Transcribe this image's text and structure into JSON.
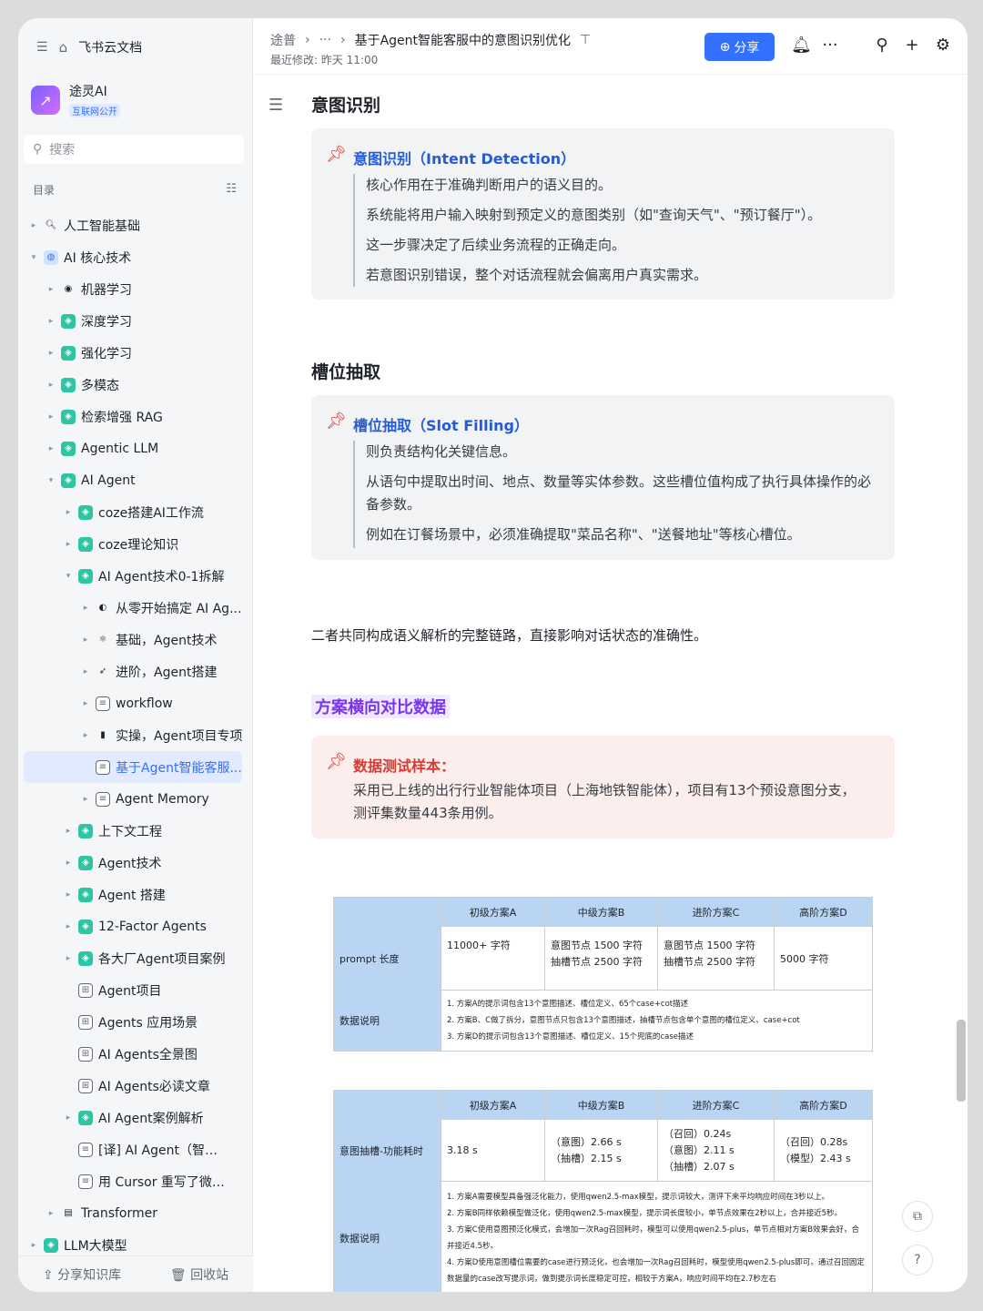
{
  "sidebar": {
    "app_name": "飞书云文档",
    "kb_name": "途灵AI",
    "kb_badge": "互联网公开",
    "search_placeholder": "搜索",
    "toc_label": "目录",
    "share_kb": "分享知识库",
    "recycle": "回收站",
    "items": [
      {
        "label": "人工智能基础",
        "depth": 0,
        "arrow": "▸",
        "icon": "magnifier-icon"
      },
      {
        "label": "AI 核心技术",
        "depth": 0,
        "arrow": "▾",
        "icon": "globe-icon"
      },
      {
        "label": "机器学习",
        "depth": 1,
        "arrow": "▸",
        "icon": "robot-icon"
      },
      {
        "label": "深度学习",
        "depth": 1,
        "arrow": "▸",
        "icon": "wiki-icon"
      },
      {
        "label": "强化学习",
        "depth": 1,
        "arrow": "▸",
        "icon": "wiki-icon"
      },
      {
        "label": "多模态",
        "depth": 1,
        "arrow": "▸",
        "icon": "wiki-icon"
      },
      {
        "label": "检索增强 RAG",
        "depth": 1,
        "arrow": "▸",
        "icon": "wiki-icon"
      },
      {
        "label": "Agentic LLM",
        "depth": 1,
        "arrow": "▸",
        "icon": "wiki-icon"
      },
      {
        "label": "AI Agent",
        "depth": 1,
        "arrow": "▾",
        "icon": "wiki-icon"
      },
      {
        "label": "coze搭建AI工作流",
        "depth": 2,
        "arrow": "▸",
        "icon": "wiki-icon"
      },
      {
        "label": "coze理论知识",
        "depth": 2,
        "arrow": "▸",
        "icon": "wiki-icon"
      },
      {
        "label": "AI Agent技术0-1拆解",
        "depth": 2,
        "arrow": "▾",
        "icon": "wiki-icon"
      },
      {
        "label": "从零开始搞定 AI Ag...",
        "depth": 3,
        "arrow": "▸",
        "icon": "people-icon"
      },
      {
        "label": "基础，Agent技术",
        "depth": 3,
        "arrow": "▸",
        "icon": "atom-icon"
      },
      {
        "label": "进阶，Agent搭建",
        "depth": 3,
        "arrow": "▸",
        "icon": "rocket-icon"
      },
      {
        "label": "workflow",
        "depth": 3,
        "arrow": "▸",
        "icon": "doc-icon"
      },
      {
        "label": "实操，Agent项目专项",
        "depth": 3,
        "arrow": "▸",
        "icon": "folder-icon"
      },
      {
        "label": "基于Agent智能客服...",
        "depth": 3,
        "arrow": "",
        "icon": "doc-icon",
        "active": true
      },
      {
        "label": "Agent Memory",
        "depth": 3,
        "arrow": "▸",
        "icon": "doc-icon"
      },
      {
        "label": "上下文工程",
        "depth": 2,
        "arrow": "▸",
        "icon": "wiki-icon"
      },
      {
        "label": "Agent技术",
        "depth": 2,
        "arrow": "▸",
        "icon": "wiki-icon"
      },
      {
        "label": "Agent 搭建",
        "depth": 2,
        "arrow": "▸",
        "icon": "wiki-icon"
      },
      {
        "label": "12-Factor Agents",
        "depth": 2,
        "arrow": "▸",
        "icon": "wiki-icon"
      },
      {
        "label": "各大厂Agent项目案例",
        "depth": 2,
        "arrow": "▸",
        "icon": "wiki-icon"
      },
      {
        "label": "Agent项目",
        "depth": 2,
        "arrow": "",
        "icon": "grid-doc-icon"
      },
      {
        "label": "Agents 应用场景",
        "depth": 2,
        "arrow": "",
        "icon": "grid-doc-icon"
      },
      {
        "label": "AI Agents全景图",
        "depth": 2,
        "arrow": "",
        "icon": "grid-doc-icon"
      },
      {
        "label": "AI Agents必读文章",
        "depth": 2,
        "arrow": "",
        "icon": "grid-doc-icon"
      },
      {
        "label": "AI Agent案例解析",
        "depth": 2,
        "arrow": "▸",
        "icon": "wiki-icon"
      },
      {
        "label": "[译] AI Agent（智能体...",
        "depth": 2,
        "arrow": "",
        "icon": "doc-icon"
      },
      {
        "label": "用 Cursor 重写了微软...",
        "depth": 2,
        "arrow": "",
        "icon": "doc-icon"
      },
      {
        "label": "Transformer",
        "depth": 1,
        "arrow": "▸",
        "icon": "book-icon"
      },
      {
        "label": "LLM大模型",
        "depth": 0,
        "arrow": "▸",
        "icon": "wiki-icon"
      }
    ]
  },
  "header": {
    "crumb_root": "途普",
    "crumb_more": "···",
    "crumb_current": "基于Agent智能客服中的意图识别优化",
    "modified": "最近修改: 昨天 11:00",
    "share_label": "分享"
  },
  "doc": {
    "h_intent": "意图识别",
    "intent_callout_title": "意图识别（Intent Detection）",
    "intent_lines": [
      "核心作用在于准确判断用户的语义目的。",
      "系统能将用户输入映射到预定义的意图类别（如\"查询天气\"、\"预订餐厅\"）。",
      "这一步骤决定了后续业务流程的正确走向。",
      "若意图识别错误，整个对话流程就会偏离用户真实需求。"
    ],
    "h_slot": "槽位抽取",
    "slot_callout_title": "槽位抽取（Slot Filling）",
    "slot_lines": [
      "则负责结构化关键信息。",
      "从语句中提取出时间、地点、数量等实体参数。这些槽位值构成了执行具体操作的必备参数。",
      "例如在订餐场景中，必须准确提取\"菜品名称\"、\"送餐地址\"等核心槽位。"
    ],
    "summary": "二者共同构成语义解析的完整链路，直接影响对话状态的准确性。",
    "h_compare": "方案横向对比数据",
    "test_title": "数据测试样本：",
    "test_body": "采用已上线的出行行业智能体项目（上海地铁智能体），项目有13个预设意图分支，测评集数量443条用例。"
  },
  "table1": {
    "headers": [
      "",
      "初级方案A",
      "中级方案B",
      "进阶方案C",
      "高阶方案D"
    ],
    "row1_label": "prompt 长度",
    "row1": [
      "11000+ 字符",
      "意图节点 1500 字符",
      "抽槽节点 2500 字符",
      "意图节点 1500 字符",
      "抽槽节点 2500 字符",
      "5000 字符"
    ],
    "row2_label": "数据说明",
    "notes": [
      "1.   方案A的提示词包含13个意图描述、槽位定义、65个case+cot描述",
      "2.   方案B、C做了拆分，意图节点只包含13个意图描述，抽槽节点包含单个意图的槽位定义、case+cot",
      "3.   方案D的提示词包含13个意图描述、槽位定义、15个兜底的case描述"
    ]
  },
  "table2": {
    "headers": [
      "",
      "初级方案A",
      "中级方案B",
      "进阶方案C",
      "高阶方案D"
    ],
    "row1_label": "意图抽槽-功能耗时",
    "a": "3.18 s",
    "b1": "（意图）2.66 s",
    "b2": "（抽槽）2.15 s",
    "c1": "（召回）0.24s",
    "c2": "（意图）2.11 s",
    "c3": "（抽槽）2.07 s",
    "d1": "（召回）0.28s",
    "d2": "（模型）2.43 s",
    "row2_label": "数据说明",
    "notes": [
      "1.   方案A需要模型具备强泛化能力，使用qwen2.5-max模型，提示词较大，测评下来平均响应时间在3秒以上。",
      "2.   方案B同样依赖模型做泛化，使用qwen2.5-max模型，提示词长度较小，单节点效果在2秒以上，合并接近5秒。",
      "3.   方案C使用意图预泛化模式，会增加一次Rag召回耗时，模型可以使用qwen2.5-plus，单节点相对方案B效果会好，合并接近4.5秒。",
      "4.   方案D使用意图槽位需要的case进行预泛化，也会增加一次Rag召回耗时，模型使用qwen2.5-plus即可。通过召回固定数据量的case改写提示词，做到提示词长度稳定可控，相较于方案A，响应时间平均在2.7秒左右"
    ]
  }
}
